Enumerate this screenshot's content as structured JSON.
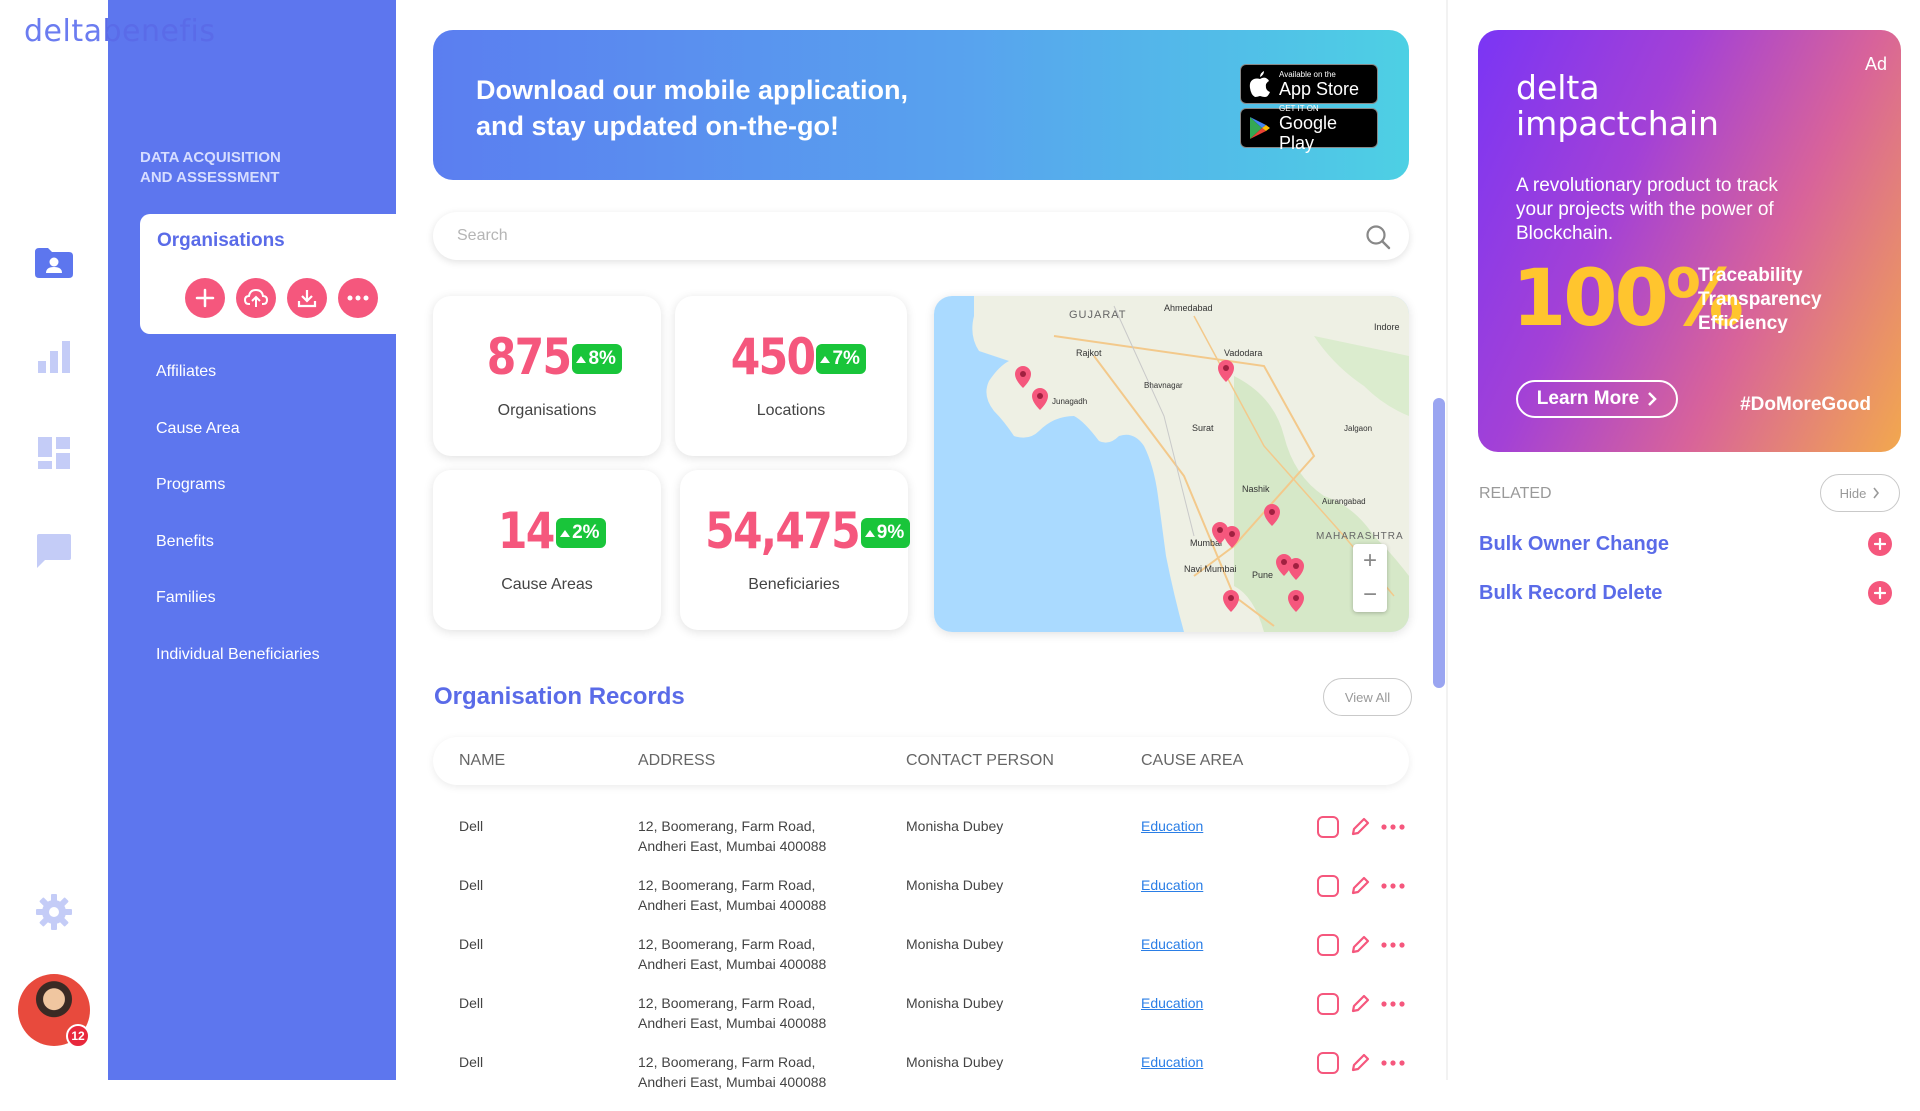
{
  "app": {
    "logo_part1": "delta",
    "logo_part2": "benefis"
  },
  "sidebar": {
    "section_line1": "DATA ACQUISITION",
    "section_line2": "AND ASSESSMENT",
    "active": {
      "label": "Organisations"
    },
    "actions": [
      "add-icon",
      "upload-icon",
      "download-icon",
      "more-icon"
    ],
    "items": [
      {
        "label": "Affiliates"
      },
      {
        "label": "Cause Area"
      },
      {
        "label": "Programs"
      },
      {
        "label": "Benefits"
      },
      {
        "label": "Families"
      },
      {
        "label": "Individual Beneficiaries"
      }
    ]
  },
  "rail": {
    "icons": [
      "contacts-folder-icon",
      "bar-chart-icon",
      "dashboard-icon",
      "chat-icon",
      "settings-icon"
    ],
    "notification_count": "12"
  },
  "banner": {
    "line1": "Download our mobile application,",
    "line2": "and stay updated on-the-go!",
    "appstore_small": "Available on the",
    "appstore_big": "App Store",
    "googleplay_small": "GET IT ON",
    "googleplay_big": "Google Play"
  },
  "search": {
    "placeholder": "Search",
    "value": ""
  },
  "stats": [
    {
      "value": "875",
      "change": "8%",
      "label": "Organisations"
    },
    {
      "value": "450",
      "change": "7%",
      "label": "Locations"
    },
    {
      "value": "14",
      "change": "2%",
      "label": "Cause Areas"
    },
    {
      "value": "54,475",
      "change": "9%",
      "label": "Beneficiaries"
    }
  ],
  "map": {
    "labels": {
      "gujarat": "GUJARAT",
      "maharashtra": "MAHARASHTRA",
      "ahmedabad": "Ahmedabad",
      "vadodara": "Vadodara",
      "rajkot": "Rajkot",
      "surat": "Surat",
      "nashik": "Nashik",
      "mumbai": "Mumbai",
      "pune": "Pune",
      "indore": "Indore",
      "aurangabad": "Aurangabad",
      "jalgaon": "Jalgaon",
      "bhavnagar": "Bhavnagar",
      "junagadh": "Junagadh",
      "navi_mumbai": "Navi Mumbai"
    },
    "zoom_in": "+",
    "zoom_out": "−"
  },
  "records": {
    "title": "Organisation Records",
    "view_all": "View All",
    "columns": [
      "NAME",
      "ADDRESS",
      "CONTACT PERSON",
      "CAUSE AREA"
    ],
    "rows": [
      {
        "name": "Dell",
        "address1": "12, Boomerang, Farm Road,",
        "address2": "Andheri East, Mumbai 400088",
        "contact": "Monisha Dubey",
        "cause": "Education"
      },
      {
        "name": "Dell",
        "address1": "12, Boomerang, Farm Road,",
        "address2": "Andheri East, Mumbai 400088",
        "contact": "Monisha Dubey",
        "cause": "Education"
      },
      {
        "name": "Dell",
        "address1": "12, Boomerang, Farm Road,",
        "address2": "Andheri East, Mumbai 400088",
        "contact": "Monisha Dubey",
        "cause": "Education"
      },
      {
        "name": "Dell",
        "address1": "12, Boomerang, Farm Road,",
        "address2": "Andheri East, Mumbai 400088",
        "contact": "Monisha Dubey",
        "cause": "Education"
      },
      {
        "name": "Dell",
        "address1": "12, Boomerang, Farm Road,",
        "address2": "Andheri East, Mumbai 400088",
        "contact": "Monisha Dubey",
        "cause": "Education"
      }
    ]
  },
  "ad": {
    "tag": "Ad",
    "brand1": "delta",
    "brand2": "impactchain",
    "description": "A revolutionary product to track your projects with the power of Blockchain.",
    "big": "100%",
    "points": [
      "Traceability",
      "Transparency",
      "Efficiency"
    ],
    "cta": "Learn More",
    "hashtag": "#DoMoreGood"
  },
  "related": {
    "title": "RELATED",
    "hide": "Hide",
    "items": [
      {
        "label": "Bulk Owner Change"
      },
      {
        "label": "Bulk Record Delete"
      }
    ]
  },
  "colors": {
    "primary": "#5d76ee",
    "accent": "#f5577d",
    "positive": "#19c53a",
    "link": "#2a7ee6"
  }
}
